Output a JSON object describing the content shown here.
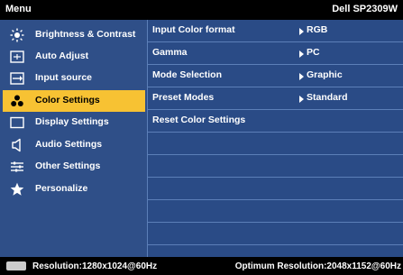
{
  "header": {
    "title": "Menu",
    "model": "Dell SP2309W"
  },
  "menu": [
    {
      "label": "Brightness & Contrast",
      "icon": "brightness-icon"
    },
    {
      "label": "Auto Adjust",
      "icon": "auto-adjust-icon"
    },
    {
      "label": "Input source",
      "icon": "input-source-icon"
    },
    {
      "label": "Color Settings",
      "icon": "color-settings-icon",
      "selected": true
    },
    {
      "label": "Display Settings",
      "icon": "display-settings-icon"
    },
    {
      "label": "Audio Settings",
      "icon": "speaker-icon"
    },
    {
      "label": "Other Settings",
      "icon": "sliders-icon"
    },
    {
      "label": "Personalize",
      "icon": "star-icon"
    }
  ],
  "settings": [
    {
      "name": "Input Color format",
      "value": "RGB"
    },
    {
      "name": "Gamma",
      "value": "PC"
    },
    {
      "name": "Mode Selection",
      "value": "Graphic"
    },
    {
      "name": "Preset Modes",
      "value": "Standard"
    },
    {
      "name": "Reset Color Settings",
      "value": ""
    }
  ],
  "status": {
    "resolution": "Resolution:1280x1024@60Hz",
    "optimum": "Optimum Resolution:2048x1152@60Hz",
    "connector_icon": "dvi-connector-icon"
  },
  "colors": {
    "panel_left": "#2f4f88",
    "panel_right": "#2a4b86",
    "selected_bg": "#f7c233",
    "divider": "#5c7fb8"
  }
}
